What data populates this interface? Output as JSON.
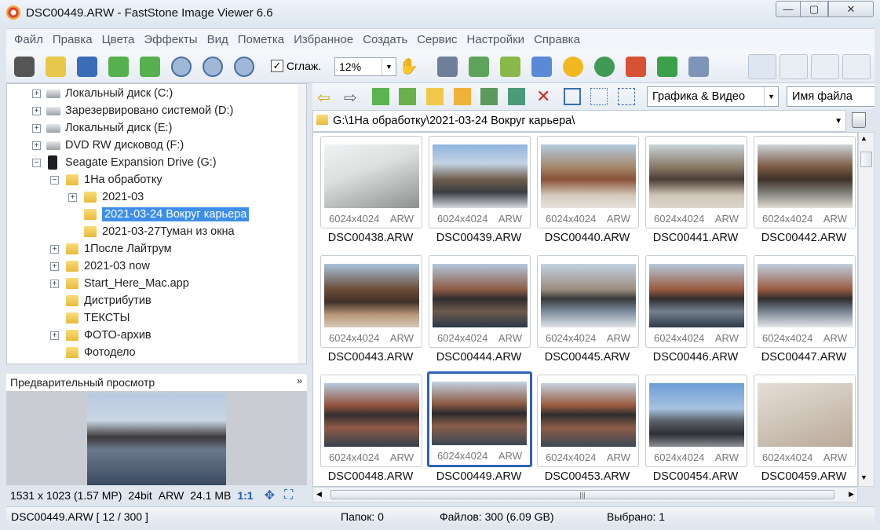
{
  "window": {
    "title": "DSC00449.ARW  -  FastStone Image Viewer 6.6"
  },
  "menu": [
    "Файл",
    "Правка",
    "Цвета",
    "Эффекты",
    "Вид",
    "Пометка",
    "Избранное",
    "Создать",
    "Сервис",
    "Настройки",
    "Справка"
  ],
  "toolbar": {
    "smooth_label": "Сглаж.",
    "smooth_checked": "✓",
    "zoom_value": "12%"
  },
  "tree": {
    "items": [
      {
        "label": "Локальный диск (C:)"
      },
      {
        "label": "Зарезервировано системой (D:)"
      },
      {
        "label": "Локальный диск (E:)"
      },
      {
        "label": "DVD RW дисковод (F:)"
      },
      {
        "label": "Seagate Expansion Drive (G:)"
      },
      {
        "label": "1На обработку"
      },
      {
        "label": "2021-03"
      },
      {
        "label": "2021-03-24 Вокруг карьера"
      },
      {
        "label": "2021-03-27Туман из окна"
      },
      {
        "label": "1После Лайтрум"
      },
      {
        "label": "2021-03 now"
      },
      {
        "label": "Start_Here_Mac.app"
      },
      {
        "label": "Дистрибутив"
      },
      {
        "label": "ТЕКСТЫ"
      },
      {
        "label": "ФОТО-архив"
      },
      {
        "label": "Фотоделo"
      }
    ]
  },
  "preview": {
    "title": "Предварительный просмотр",
    "dimensions": "1531 x 1023 (1.57 MP)",
    "bitdepth": "24bit",
    "format": "ARW",
    "size": "24.1 MB",
    "ratio": "1:1"
  },
  "browser": {
    "filter": "Графика & Видео",
    "sort": "Имя файла",
    "path": "G:\\1На обработку\\2021-03-24 Вокруг карьера\\"
  },
  "thumbnails": [
    {
      "name": "DSC00438.ARW",
      "res": "6024x4024",
      "ext": "ARW"
    },
    {
      "name": "DSC00439.ARW",
      "res": "6024x4024",
      "ext": "ARW"
    },
    {
      "name": "DSC00440.ARW",
      "res": "6024x4024",
      "ext": "ARW"
    },
    {
      "name": "DSC00441.ARW",
      "res": "6024x4024",
      "ext": "ARW"
    },
    {
      "name": "DSC00442.ARW",
      "res": "6024x4024",
      "ext": "ARW"
    },
    {
      "name": "DSC00443.ARW",
      "res": "6024x4024",
      "ext": "ARW"
    },
    {
      "name": "DSC00444.ARW",
      "res": "6024x4024",
      "ext": "ARW"
    },
    {
      "name": "DSC00445.ARW",
      "res": "6024x4024",
      "ext": "ARW"
    },
    {
      "name": "DSC00446.ARW",
      "res": "6024x4024",
      "ext": "ARW"
    },
    {
      "name": "DSC00447.ARW",
      "res": "6024x4024",
      "ext": "ARW"
    },
    {
      "name": "DSC00448.ARW",
      "res": "6024x4024",
      "ext": "ARW"
    },
    {
      "name": "DSC00449.ARW",
      "res": "6024x4024",
      "ext": "ARW"
    },
    {
      "name": "DSC00453.ARW",
      "res": "6024x4024",
      "ext": "ARW"
    },
    {
      "name": "DSC00454.ARW",
      "res": "6024x4024",
      "ext": "ARW"
    },
    {
      "name": "DSC00459.ARW",
      "res": "6024x4024",
      "ext": "ARW"
    }
  ],
  "status": {
    "file": "DSC00449.ARW [ 12 / 300 ]",
    "folders": "Папок: 0",
    "files": "Файлов: 300 (6.09 GB)",
    "selected": "Выбрано: 1"
  },
  "colors": {
    "selection": "#3d8ee9",
    "thumb_selected": "#2c63b8"
  }
}
